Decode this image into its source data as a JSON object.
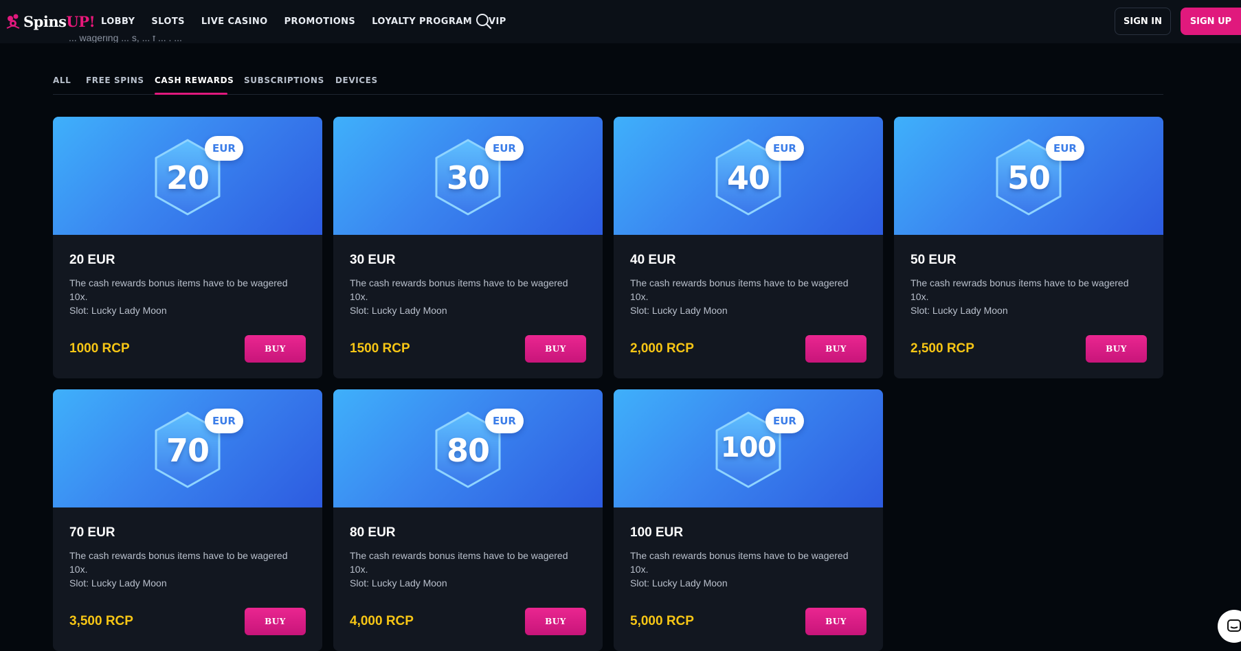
{
  "brand": {
    "name_a": "Spins",
    "name_b": "UP!"
  },
  "nav": [
    "LOBBY",
    "SLOTS",
    "LIVE CASINO",
    "PROMOTIONS",
    "LOYALTY PROGRAM",
    "VIP"
  ],
  "auth": {
    "sign_in": "SIGN IN",
    "sign_up": "SIGN UP"
  },
  "partial_text": "... wagering ... s, ... f ... . ...",
  "tabs": [
    "ALL",
    "FREE SPINS",
    "CASH REWARDS",
    "SUBSCRIPTIONS",
    "DEVICES"
  ],
  "active_tab": "CASH REWARDS",
  "currency_badge": "EUR",
  "buy_label": "BUY",
  "cards": [
    {
      "amount": "20",
      "title": "20 EUR",
      "desc1": "The cash rewards bonus items have to be wagered 10x.",
      "desc2": "Slot: Lucky Lady Moon",
      "price": "1000 RCP",
      "buy": "BUY"
    },
    {
      "amount": "30",
      "title": "30 EUR",
      "desc1": "The cash rewards bonus items have to be wagered 10x.",
      "desc2": "Slot: Lucky Lady Moon",
      "price": "1500 RCP",
      "buy": "BUY"
    },
    {
      "amount": "40",
      "title": "40 EUR",
      "desc1": "The cash rewards bonus items have to be wagered 10x.",
      "desc2": "Slot: Lucky Lady Moon",
      "price": "2,000 RCP",
      "buy": "BUY"
    },
    {
      "amount": "50",
      "title": "50 EUR",
      "desc1": "The cash rewrads bonus items have to be wagered 10x.",
      "desc2": "Slot: Lucky Lady Moon",
      "price": "2,500 RCP",
      "buy": "BUY"
    },
    {
      "amount": "70",
      "title": "70 EUR",
      "desc1": "The cash rewards bonus items have to be wagered 10x.",
      "desc2": "Slot: Lucky Lady Moon",
      "price": "3,500 RCP",
      "buy": "BUY"
    },
    {
      "amount": "80",
      "title": "80 EUR",
      "desc1": "The cash rewards bonus items have to be wagered 10x.",
      "desc2": "Slot: Lucky Lady Moon",
      "price": "4,000 RCP",
      "buy": "BUY"
    },
    {
      "amount": "100",
      "title": "100 EUR",
      "desc1": "The cash rewards bonus items have to be wagered 10x.",
      "desc2": "Slot: Lucky Lady Moon",
      "price": "5,000 RCP",
      "buy": "BUY"
    }
  ],
  "colors": {
    "accent": "#e0197d",
    "price": "#f7c615",
    "banner_start": "#3fb0fb",
    "banner_end": "#2d5be0",
    "background": "#04080d",
    "card": "#121720"
  },
  "icons": {
    "logo": "jester-logo-icon",
    "search": "search-icon",
    "chat": "chat-bubble-icon"
  }
}
